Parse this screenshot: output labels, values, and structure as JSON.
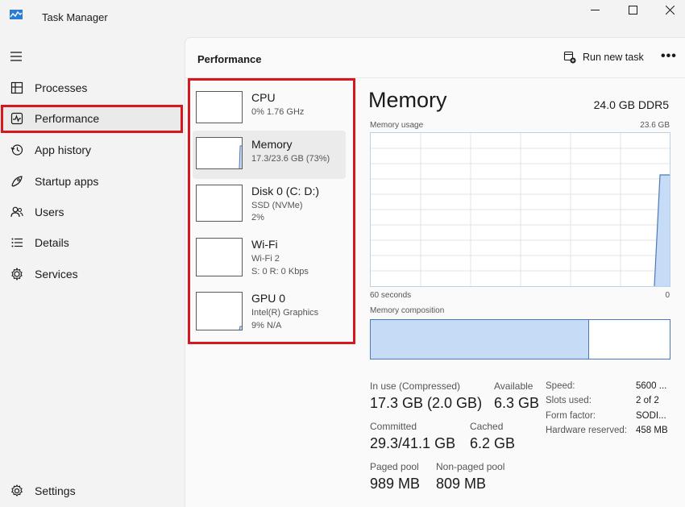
{
  "window": {
    "title": "Task Manager"
  },
  "controls": {
    "minimize": "—",
    "maximize": "☐",
    "close": "✕"
  },
  "sidebar": {
    "items": [
      {
        "key": "processes",
        "label": "Processes"
      },
      {
        "key": "performance",
        "label": "Performance"
      },
      {
        "key": "app-history",
        "label": "App history"
      },
      {
        "key": "startup-apps",
        "label": "Startup apps"
      },
      {
        "key": "users",
        "label": "Users"
      },
      {
        "key": "details",
        "label": "Details"
      },
      {
        "key": "services",
        "label": "Services"
      }
    ],
    "settings_label": "Settings",
    "selected": "performance"
  },
  "header": {
    "title": "Performance",
    "run_task_label": "Run new task",
    "more_label": "•••"
  },
  "devices": [
    {
      "name": "CPU",
      "line1": "0%  1.76 GHz",
      "line2": ""
    },
    {
      "name": "Memory",
      "line1": "17.3/23.6 GB (73%)",
      "line2": ""
    },
    {
      "name": "Disk 0 (C: D:)",
      "line1": "SSD (NVMe)",
      "line2": "2%"
    },
    {
      "name": "Wi-Fi",
      "line1": "Wi-Fi 2",
      "line2": "S: 0  R: 0 Kbps"
    },
    {
      "name": "GPU 0",
      "line1": "Intel(R) Graphics",
      "line2": "9%  N/A"
    }
  ],
  "memory": {
    "heading": "Memory",
    "total": "24.0 GB DDR5",
    "usage_label": "Memory usage",
    "usage_max": "23.6 GB",
    "time_label_left": "60 seconds",
    "time_label_right": "0",
    "composition_label": "Memory composition",
    "composition_in_use_fraction": 0.73,
    "stats": {
      "in_use_label": "In use (Compressed)",
      "in_use_value": "17.3 GB (2.0 GB)",
      "available_label": "Available",
      "available_value": "6.3 GB",
      "committed_label": "Committed",
      "committed_value": "29.3/41.1 GB",
      "cached_label": "Cached",
      "cached_value": "6.2 GB",
      "paged_label": "Paged pool",
      "paged_value": "989 MB",
      "nonpaged_label": "Non-paged pool",
      "nonpaged_value": "809 MB"
    },
    "specs": {
      "speed_label": "Speed:",
      "speed_value": "5600 ...",
      "slots_label": "Slots used:",
      "slots_value": "2 of 2",
      "form_label": "Form factor:",
      "form_value": "SODI...",
      "hw_label": "Hardware reserved:",
      "hw_value": "458 MB"
    }
  },
  "colors": {
    "accent_red": "#d6171f",
    "graph_fill": "#c6dcf6",
    "graph_line": "#4a7ab8"
  }
}
